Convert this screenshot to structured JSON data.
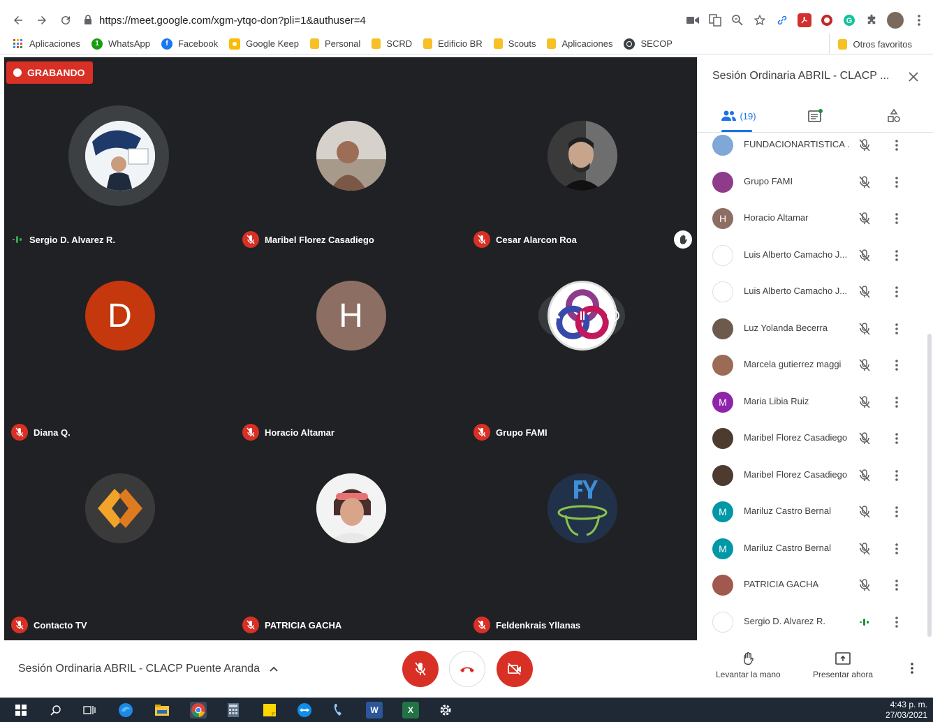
{
  "browser": {
    "url": "https://meet.google.com/xgm-ytqo-don?pli=1&authuser=4",
    "bookmarks": [
      {
        "label": "Aplicaciones",
        "icon": "apps-grid-icon"
      },
      {
        "label": "WhatsApp",
        "icon": "whatsapp-icon"
      },
      {
        "label": "Facebook",
        "icon": "facebook-icon"
      },
      {
        "label": "Google Keep",
        "icon": "keep-icon"
      },
      {
        "label": "Personal",
        "icon": "folder-icon"
      },
      {
        "label": "SCRD",
        "icon": "folder-icon"
      },
      {
        "label": "Edificio BR",
        "icon": "folder-icon"
      },
      {
        "label": "Scouts",
        "icon": "folder-icon"
      },
      {
        "label": "Aplicaciones",
        "icon": "folder-icon"
      },
      {
        "label": "SECOP",
        "icon": "secop-icon"
      }
    ],
    "other_bookmarks": "Otros favoritos"
  },
  "meet": {
    "recording_label": "GRABANDO",
    "tiles": [
      {
        "name": "Sergio D. Alvarez R.",
        "speaking": true
      },
      {
        "name": "Maribel Florez Casadiego",
        "speaking": false
      },
      {
        "name": "Cesar Alarcon Roa",
        "speaking": false
      },
      {
        "name": "Diana Q.",
        "initial": "D",
        "color": "#c5370d",
        "speaking": false
      },
      {
        "name": "Horacio Altamar",
        "initial": "H",
        "color": "#8d6e63",
        "speaking": false
      },
      {
        "name": "Grupo FAMI",
        "speaking": false
      },
      {
        "name": "Contacto TV",
        "speaking": false
      },
      {
        "name": "PATRICIA GACHA",
        "speaking": false
      },
      {
        "name": "Feldenkrais Yllanas",
        "speaking": false
      }
    ],
    "panel": {
      "title": "Sesión Ordinaria ABRIL - CLACP ...",
      "people_count": "(19)",
      "people": [
        {
          "name": "FUNDACIONARTISTICA ...",
          "initial": "",
          "color": "#7fa7d8",
          "speaking": false
        },
        {
          "name": "Grupo FAMI",
          "initial": "",
          "color": "#8e3b8a",
          "speaking": false
        },
        {
          "name": "Horacio Altamar",
          "initial": "H",
          "color": "#8d6e63",
          "speaking": false
        },
        {
          "name": "Luis Alberto Camacho J...",
          "initial": "",
          "color": "#ffffff",
          "speaking": false
        },
        {
          "name": "Luis Alberto Camacho J...",
          "initial": "",
          "color": "#ffffff",
          "speaking": false
        },
        {
          "name": "Luz Yolanda Becerra",
          "initial": "",
          "color": "#6d5a4d",
          "speaking": false
        },
        {
          "name": "Marcela gutierrez maggi",
          "initial": "",
          "color": "#9c6b55",
          "speaking": false
        },
        {
          "name": "Maria Libia Ruiz",
          "initial": "M",
          "color": "#8e24aa",
          "speaking": false
        },
        {
          "name": "Maribel Florez Casadiego",
          "initial": "",
          "color": "#4e3b30",
          "speaking": false
        },
        {
          "name": "Maribel Florez Casadiego",
          "initial": "",
          "color": "#4e3b30",
          "speaking": false
        },
        {
          "name": "Mariluz Castro Bernal",
          "initial": "M",
          "color": "#0097a7",
          "speaking": false
        },
        {
          "name": "Mariluz Castro Bernal",
          "initial": "M",
          "color": "#0097a7",
          "speaking": false
        },
        {
          "name": "PATRICIA GACHA",
          "initial": "",
          "color": "#a1584e",
          "speaking": false
        },
        {
          "name": "Sergio D. Alvarez R.",
          "initial": "",
          "color": "#ffffff",
          "speaking": true
        }
      ]
    },
    "bottom": {
      "meeting_title": "Sesión Ordinaria ABRIL - CLACP Puente Aranda",
      "raise_hand": "Levantar la mano",
      "present_now": "Presentar ahora"
    }
  },
  "taskbar": {
    "time": "4:43 p. m.",
    "date": "27/03/2021"
  }
}
